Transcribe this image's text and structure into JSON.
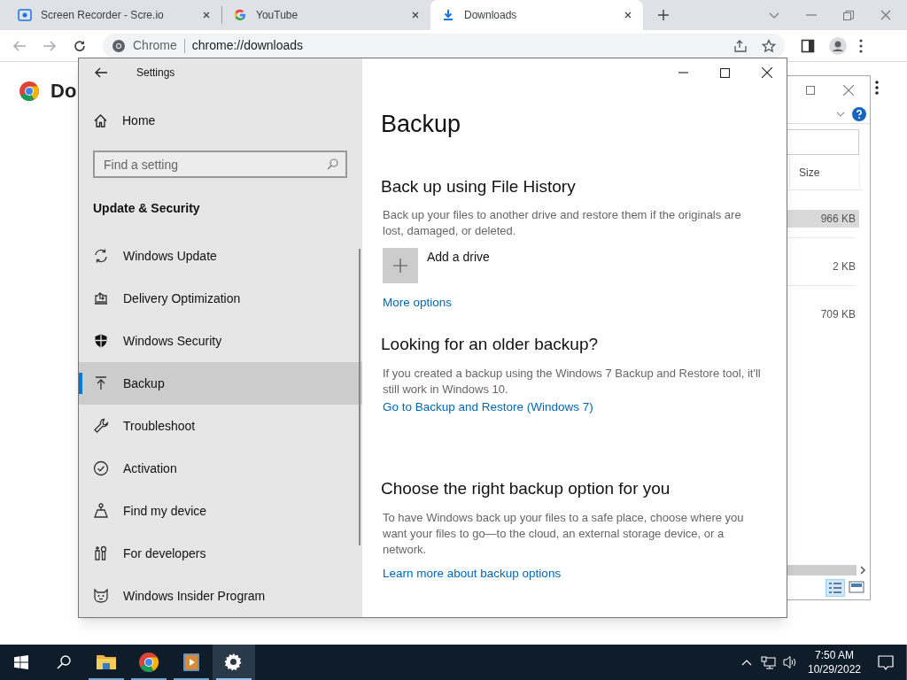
{
  "browser": {
    "tabs": [
      {
        "title": "Screen Recorder - Scre.io",
        "kind": "recorder",
        "selected": false
      },
      {
        "title": "YouTube",
        "kind": "google",
        "selected": false
      },
      {
        "title": "Downloads",
        "kind": "download",
        "selected": true
      }
    ],
    "address": {
      "site": "Chrome",
      "url": "chrome://downloads"
    },
    "page_heading": "Do"
  },
  "explorer": {
    "column": "Size",
    "rows": [
      {
        "size": "966 KB",
        "selected": true
      },
      {
        "size": "2 KB",
        "selected": false
      },
      {
        "size": "709 KB",
        "selected": false
      }
    ]
  },
  "settings": {
    "title": "Settings",
    "home": "Home",
    "search_placeholder": "Find a setting",
    "section": "Update & Security",
    "nav": [
      {
        "label": "Windows Update",
        "kind": "sync",
        "selected": false
      },
      {
        "label": "Delivery Optimization",
        "kind": "delivery",
        "selected": false
      },
      {
        "label": "Windows Security",
        "kind": "shield",
        "selected": false
      },
      {
        "label": "Backup",
        "kind": "backup",
        "selected": true
      },
      {
        "label": "Troubleshoot",
        "kind": "wrench",
        "selected": false
      },
      {
        "label": "Activation",
        "kind": "check",
        "selected": false
      },
      {
        "label": "Find my device",
        "kind": "person",
        "selected": false
      },
      {
        "label": "For developers",
        "kind": "tools",
        "selected": false
      },
      {
        "label": "Windows Insider Program",
        "kind": "insider",
        "selected": false
      }
    ],
    "page_title": "Backup",
    "sections": [
      {
        "heading": "Back up using File History",
        "body": "Back up your files to another drive and restore them if the originals are lost, damaged, or deleted.",
        "add_button": "Add a drive",
        "link": "More options"
      },
      {
        "heading": "Looking for an older backup?",
        "body": "If you created a backup using the Windows 7 Backup and Restore tool, it'll still work in Windows 10.",
        "link": "Go to Backup and Restore (Windows 7)"
      },
      {
        "heading": "Choose the right backup option for you",
        "body": "To have Windows back up your files to a safe place, choose where you want your files to go—to the cloud, an external storage device, or a network.",
        "link": "Learn more about backup options"
      }
    ]
  },
  "taskbar": {
    "apps": [
      {
        "kind": "folder",
        "selected": false
      },
      {
        "kind": "chrome",
        "selected": false
      },
      {
        "kind": "video",
        "selected": false
      },
      {
        "kind": "gear",
        "selected": true
      }
    ],
    "time": "7:50 AM",
    "date": "10/29/2022"
  }
}
